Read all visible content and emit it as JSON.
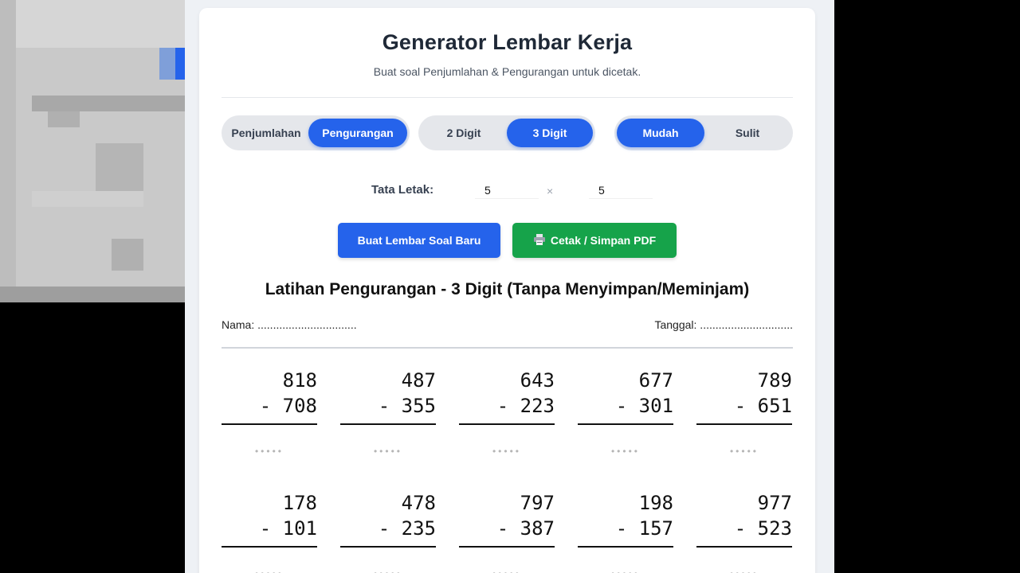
{
  "header": {
    "title": "Generator Lembar Kerja",
    "subtitle": "Buat soal Penjumlahan & Pengurangan untuk dicetak."
  },
  "operation": {
    "options": [
      "Penjumlahan",
      "Pengurangan"
    ],
    "selected": "Pengurangan"
  },
  "digits": {
    "options": [
      "2 Digit",
      "3 Digit"
    ],
    "selected": "3 Digit"
  },
  "difficulty": {
    "options": [
      "Mudah",
      "Sulit"
    ],
    "selected": "Mudah"
  },
  "layout": {
    "label": "Tata Letak:",
    "rows": "5",
    "cols": "5",
    "separator": "×"
  },
  "buttons": {
    "generate": "Buat Lembar Soal Baru",
    "print": "Cetak / Simpan PDF",
    "print_icon": "printer-icon"
  },
  "sheet": {
    "title": "Latihan Pengurangan - 3 Digit (Tanpa Menyimpan/Meminjam)",
    "name_label": "Nama: ................................",
    "date_label": "Tanggal: ..............................",
    "answer_dots": "•••••",
    "problems": [
      [
        [
          "818",
          "- 708"
        ],
        [
          "487",
          "- 355"
        ],
        [
          "643",
          "- 223"
        ],
        [
          "677",
          "- 301"
        ],
        [
          "789",
          "- 651"
        ]
      ],
      [
        [
          "178",
          "- 101"
        ],
        [
          "478",
          "- 235"
        ],
        [
          "797",
          "- 387"
        ],
        [
          "198",
          "- 157"
        ],
        [
          "977",
          "- 523"
        ]
      ]
    ]
  },
  "colors": {
    "accent": "#2563eb",
    "print_button": "#16a34a",
    "background": "#eef1f5"
  }
}
